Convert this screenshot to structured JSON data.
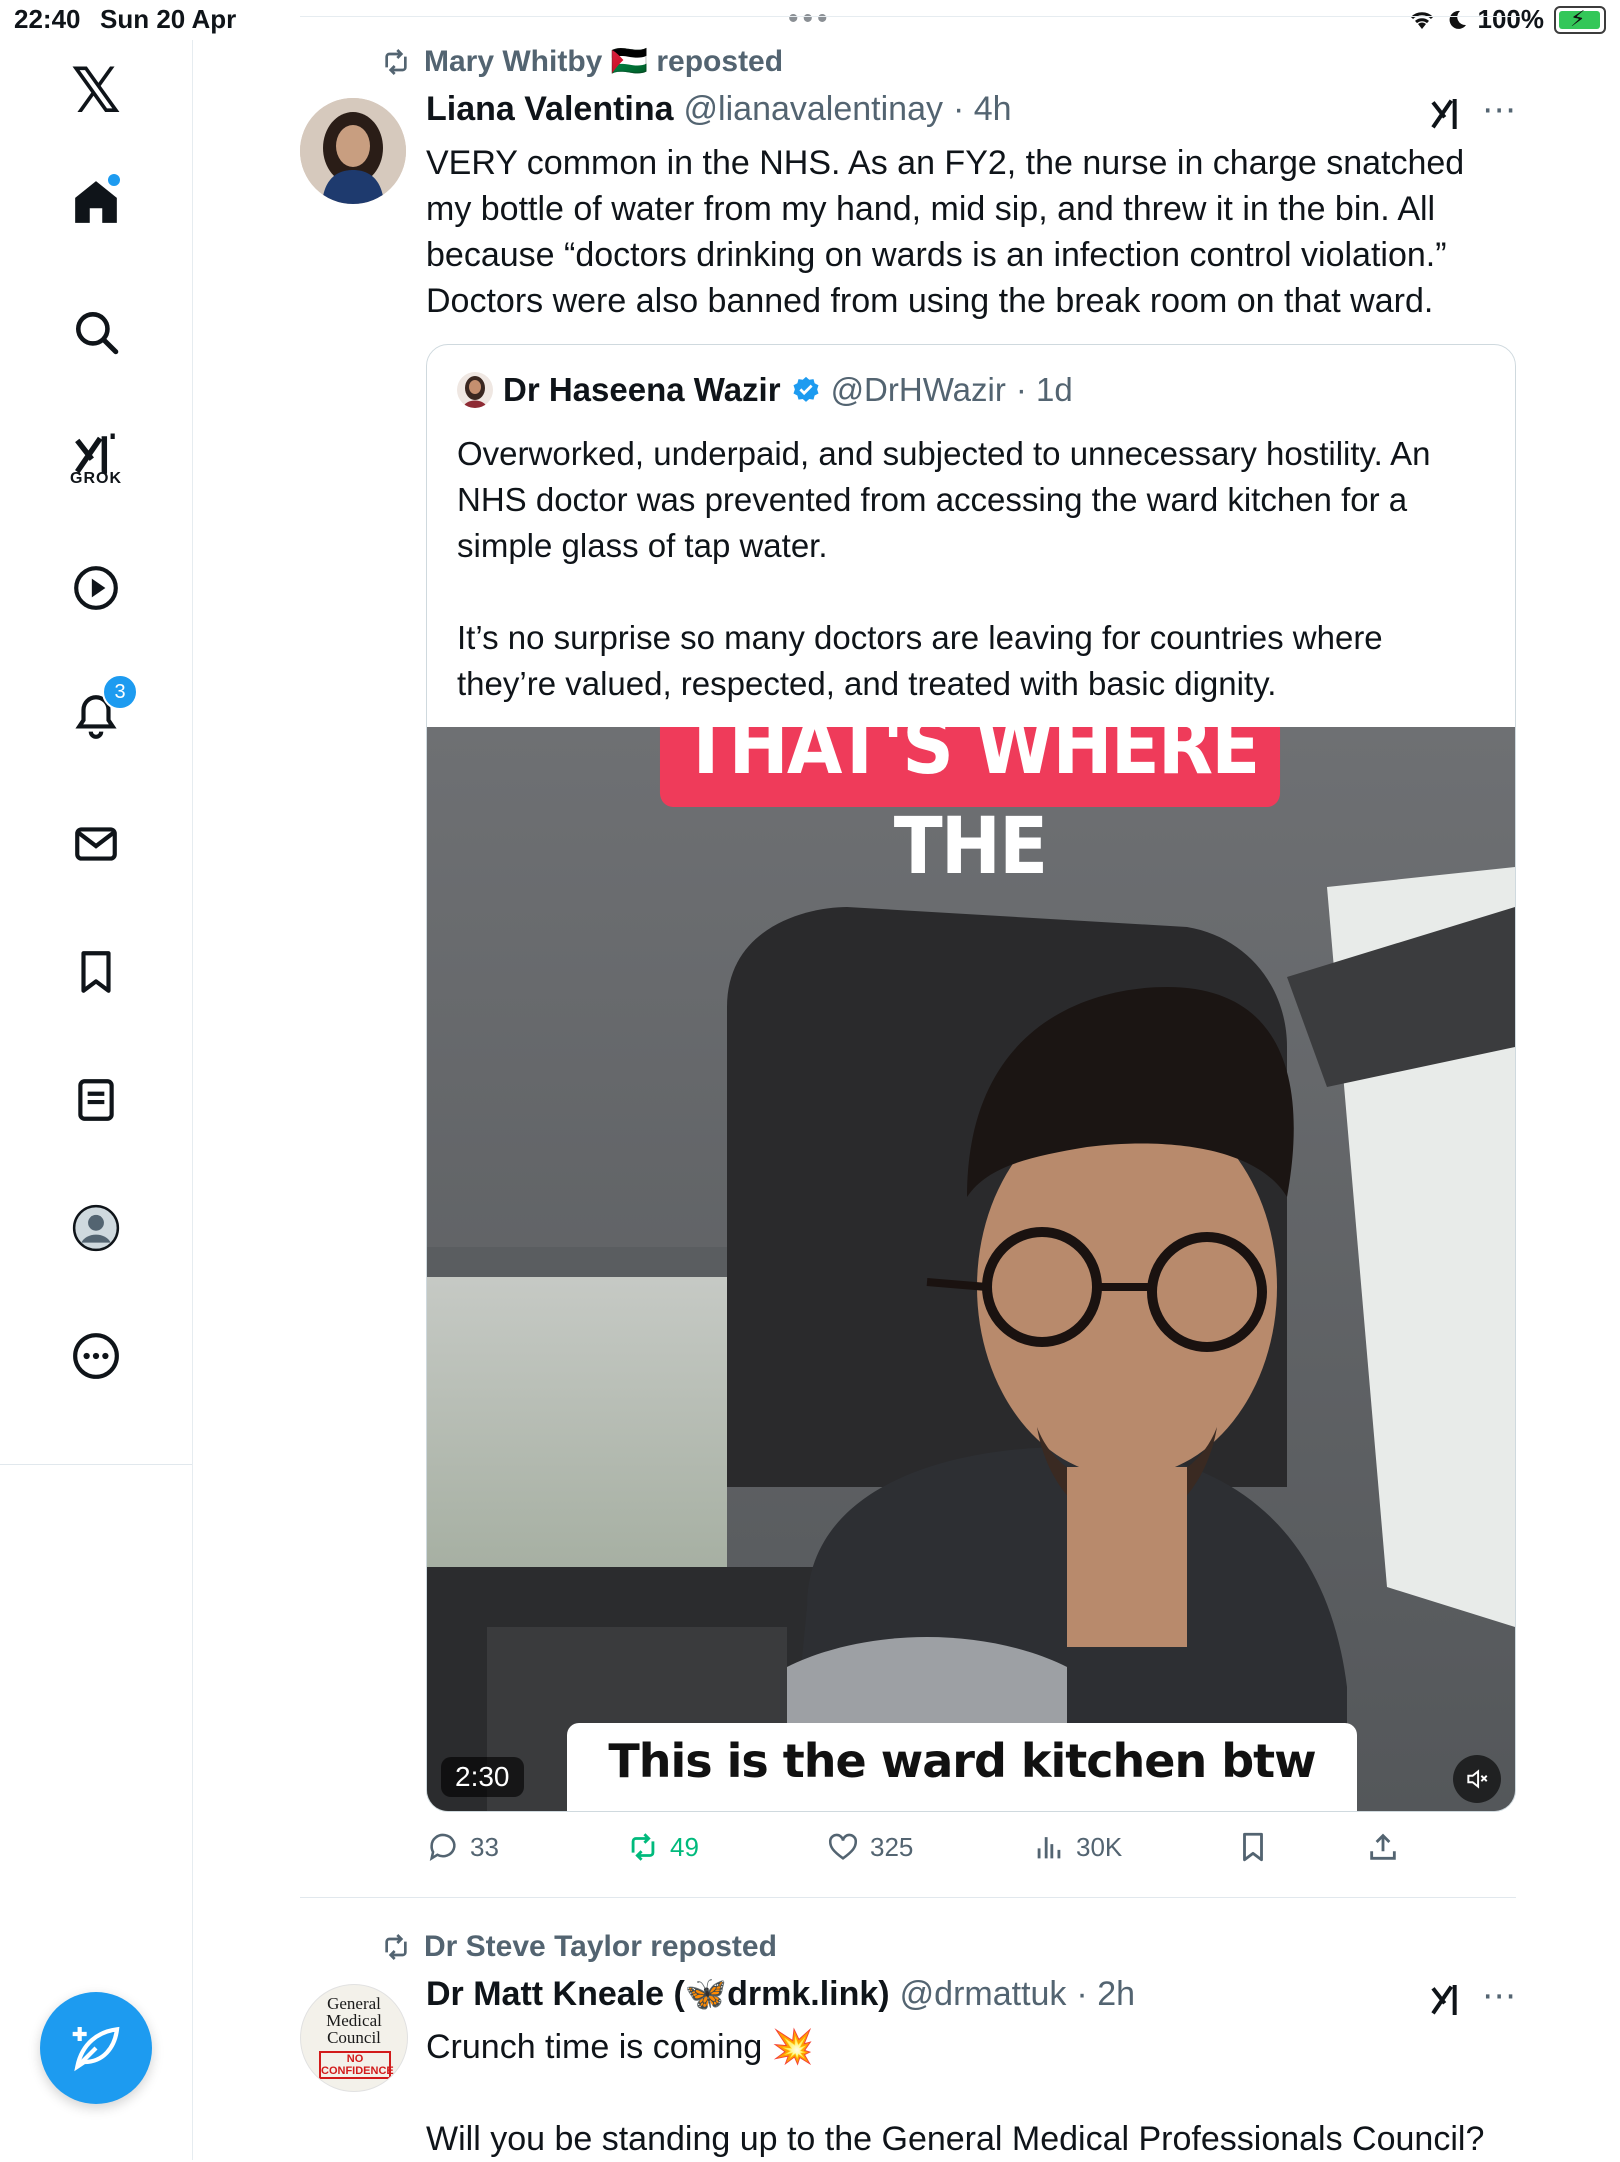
{
  "status_bar": {
    "time": "22:40",
    "date": "Sun 20 Apr",
    "battery": "100%"
  },
  "sidebar": {
    "logo": "𝕏",
    "items": [
      {
        "icon": "home-icon",
        "has_dot": true
      },
      {
        "icon": "search-icon"
      },
      {
        "icon": "grok-icon",
        "label": "GROK"
      },
      {
        "icon": "video-icon"
      },
      {
        "icon": "notifications-icon",
        "badge": "3"
      },
      {
        "icon": "messages-icon"
      },
      {
        "icon": "bookmarks-icon"
      },
      {
        "icon": "lists-icon"
      },
      {
        "icon": "profile-icon"
      },
      {
        "icon": "more-icon"
      }
    ],
    "compose_icon": "compose-icon"
  },
  "feed": {
    "post1": {
      "reposted_by": "Mary Whitby 🇵🇸 reposted",
      "author_name": "Liana Valentina",
      "author_handle": "@lianavalentinay",
      "time": "· 4h",
      "text": "VERY common in the NHS. As an FY2, the nurse in charge snatched my bottle of water from my hand, mid sip, and threw it in the bin. All because “doctors drinking on wards is an infection control violation.” Doctors were also banned from using the break room on that ward.",
      "quote": {
        "author_name": "Dr Haseena Wazir",
        "author_handle": "@DrHWazir",
        "time": "· 1d",
        "text_p1": "Overworked, underpaid, and subjected to unnecessary hostility. An NHS doctor was prevented from accessing the ward kitchen for a simple glass of tap water.",
        "text_p2": "It’s no surprise so many doctors are leaving for countries where they’re valued, respected, and treated with basic dignity.",
        "video": {
          "caption_top": "THAT'S WHERE THE",
          "caption_bottom": "This is the ward kitchen btw which",
          "duration": "2:30"
        }
      },
      "stats": {
        "replies": "33",
        "reposts": "49",
        "likes": "325",
        "views": "30K"
      }
    },
    "post2": {
      "reposted_by": "Dr Steve Taylor reposted",
      "author_name": "Dr Matt Kneale (🦋drmk.link)",
      "author_handle": "@drmattuk",
      "time": "· 2h",
      "text_line1": "Crunch time is coming 💥",
      "text_line2": "Will you be standing up to the General Medical Professionals Council?",
      "avatar_text": {
        "line1": "General",
        "line2": "Medical",
        "line3": "Council",
        "stamp1": "NO",
        "stamp2": "CONFIDENCE"
      }
    }
  },
  "colors": {
    "accent": "#1d9bf0",
    "repost_green": "#00ba7c",
    "secondary_text": "#536471",
    "caption_pink": "#ef3b5a"
  }
}
